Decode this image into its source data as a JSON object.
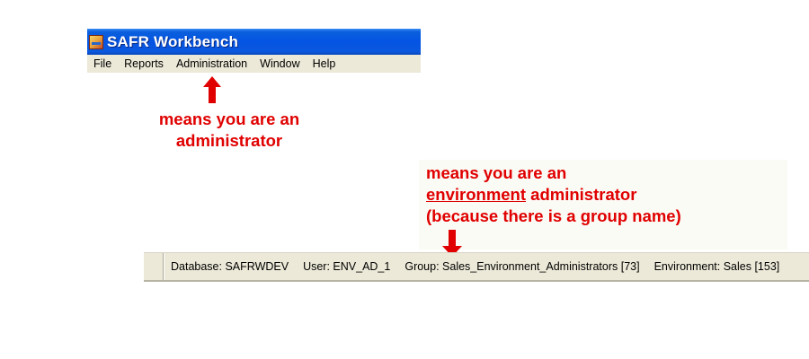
{
  "window": {
    "title": "SAFR Workbench",
    "icon": "safr-app-icon",
    "menu": [
      "File",
      "Reports",
      "Administration",
      "Window",
      "Help"
    ]
  },
  "annotations": {
    "admin_note": {
      "line1": "means you are an",
      "line2": "administrator"
    },
    "env_admin_note": {
      "line1": "means you are an",
      "line2_underlined": "environment",
      "line2_rest": " administrator",
      "line3": "(because there is a group name)"
    },
    "color": "#e00000"
  },
  "statusbar": {
    "database": "Database: SAFRWDEV",
    "user": "User: ENV_AD_1",
    "group": "Group: Sales_Environment_Administrators [73]",
    "environment": "Environment: Sales [153]"
  },
  "colors": {
    "titlebar": "#0554e3",
    "chrome": "#ece9d8",
    "annotation": "#e00000"
  }
}
